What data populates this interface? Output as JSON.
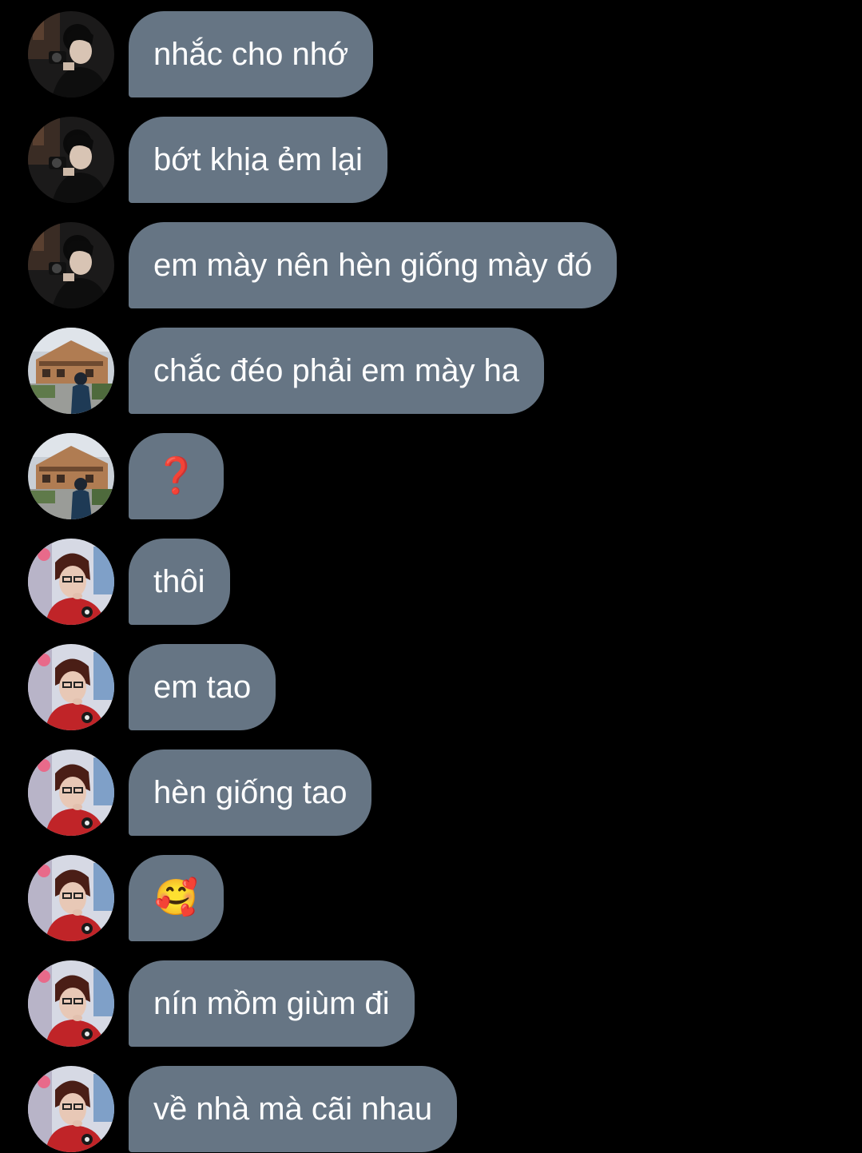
{
  "colors": {
    "background": "#000000",
    "bubble": "#667584",
    "text": "#ffffff"
  },
  "messages": [
    {
      "sender": "user-a",
      "avatar_icon": "user-a-avatar-icon",
      "text": "nhắc cho nhớ"
    },
    {
      "sender": "user-a",
      "avatar_icon": "user-a-avatar-icon",
      "text": "bớt khịa ẻm lại"
    },
    {
      "sender": "user-a",
      "avatar_icon": "user-a-avatar-icon",
      "text": "em mày nên hèn giống mày đó"
    },
    {
      "sender": "user-b",
      "avatar_icon": "user-b-avatar-icon",
      "text": "chắc đéo phải em mày ha"
    },
    {
      "sender": "user-b",
      "avatar_icon": "user-b-avatar-icon",
      "text": "❓"
    },
    {
      "sender": "user-c",
      "avatar_icon": "user-c-avatar-icon",
      "text": "thôi"
    },
    {
      "sender": "user-c",
      "avatar_icon": "user-c-avatar-icon",
      "text": "em tao"
    },
    {
      "sender": "user-c",
      "avatar_icon": "user-c-avatar-icon",
      "text": "hèn giống tao"
    },
    {
      "sender": "user-c",
      "avatar_icon": "user-c-avatar-icon",
      "text": "🥰"
    },
    {
      "sender": "user-c",
      "avatar_icon": "user-c-avatar-icon",
      "text": "nín mồm giùm đi"
    },
    {
      "sender": "user-c",
      "avatar_icon": "user-c-avatar-icon",
      "text": "về nhà mà cãi nhau"
    }
  ]
}
